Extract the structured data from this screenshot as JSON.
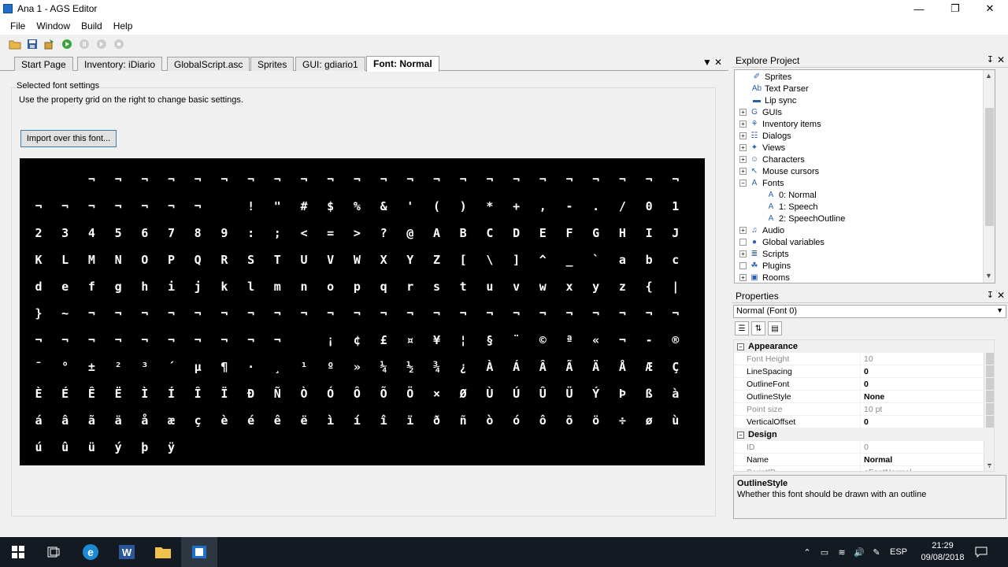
{
  "window": {
    "title": "Ana 1 - AGS Editor",
    "minimize": "—",
    "maximize": "❐",
    "close": "✕"
  },
  "menu": [
    "File",
    "Window",
    "Build",
    "Help"
  ],
  "toolbar_icons": [
    "open-folder-icon",
    "save-icon",
    "build-icon",
    "run-icon",
    "pause-icon",
    "step-icon",
    "stop-icon"
  ],
  "tabs": [
    {
      "label": "Start Page",
      "active": false
    },
    {
      "label": "Inventory: iDiario",
      "active": false
    },
    {
      "label": "GlobalScript.asc",
      "active": false
    },
    {
      "label": "Sprites",
      "active": false
    },
    {
      "label": "GUI: gdiario1",
      "active": false
    },
    {
      "label": "Font: Normal",
      "active": true
    }
  ],
  "tab_controls": {
    "dropdown": "▼",
    "close": "✕"
  },
  "font_editor": {
    "legend": "Selected font settings",
    "description": "Use the property grid on the right to change basic settings.",
    "import_button": "Import over this font...",
    "glyph_rows": [
      "  ¬¬¬¬¬¬¬¬¬¬¬¬¬¬¬¬¬¬¬¬¬¬¬",
      "¬¬¬¬¬¬¬ !\"#$%&'()*+,-./01",
      "23456789:;<=>?@ABCDEFGHIJ",
      "KLMNOPQRSTUVWXYZ[\\]^_`abc",
      "defghijklmnopqrstuvwxyz{|",
      "}~¬¬¬¬¬¬¬¬¬¬¬¬¬¬¬¬¬¬¬¬¬¬¬",
      "¬¬¬¬¬¬¬¬¬¬ ¡¢£¤¥¦§¨©ª«¬-®",
      "¯°±²³´µ¶·¸¹º»¼½¾¿ÀÁÂÃÄÅÆÇ",
      "ÈÉÊËÌÍÎÏÐÑÒÓÔÕÖ×ØÙÚÛÜÝÞßà",
      "áâãäåæçèéêëìíîïðñòóôõö÷øù",
      "úûüýþÿ"
    ]
  },
  "explore": {
    "title": "Explore Project",
    "pin": "↧",
    "close": "✕",
    "items": [
      {
        "label": "Sprites",
        "icon": "sprites-icon",
        "glyph": "✐",
        "level": 1,
        "expander": ""
      },
      {
        "label": "Text Parser",
        "icon": "text-parser-icon",
        "glyph": "Ab",
        "level": 1,
        "expander": ""
      },
      {
        "label": "Lip sync",
        "icon": "lip-sync-icon",
        "glyph": "▬",
        "level": 1,
        "expander": ""
      },
      {
        "label": "GUIs",
        "icon": "gui-icon",
        "glyph": "G",
        "level": 0,
        "expander": "+"
      },
      {
        "label": "Inventory items",
        "icon": "inventory-icon",
        "glyph": "⚘",
        "level": 0,
        "expander": "+"
      },
      {
        "label": "Dialogs",
        "icon": "dialogs-icon",
        "glyph": "☷",
        "level": 0,
        "expander": "+"
      },
      {
        "label": "Views",
        "icon": "views-icon",
        "glyph": "✦",
        "level": 0,
        "expander": "+"
      },
      {
        "label": "Characters",
        "icon": "characters-icon",
        "glyph": "☺",
        "level": 0,
        "expander": "+"
      },
      {
        "label": "Mouse cursors",
        "icon": "mouse-cursor-icon",
        "glyph": "↖",
        "level": 0,
        "expander": "+"
      },
      {
        "label": "Fonts",
        "icon": "fonts-icon",
        "glyph": "A",
        "level": 0,
        "expander": "−"
      },
      {
        "label": "0: Normal",
        "icon": "font-icon",
        "glyph": "A",
        "level": 2,
        "expander": ""
      },
      {
        "label": "1: Speech",
        "icon": "font-icon",
        "glyph": "A",
        "level": 2,
        "expander": ""
      },
      {
        "label": "2: SpeechOutline",
        "icon": "font-icon",
        "glyph": "A",
        "level": 2,
        "expander": ""
      },
      {
        "label": "Audio",
        "icon": "audio-icon",
        "glyph": "♫",
        "level": 0,
        "expander": "+"
      },
      {
        "label": "Global variables",
        "icon": "global-variables-icon",
        "glyph": "●",
        "level": 0,
        "expander": ""
      },
      {
        "label": "Scripts",
        "icon": "scripts-icon",
        "glyph": "≣",
        "level": 0,
        "expander": "+"
      },
      {
        "label": "Plugins",
        "icon": "plugins-icon",
        "glyph": "☘",
        "level": 0,
        "expander": ""
      },
      {
        "label": "Rooms",
        "icon": "rooms-icon",
        "glyph": "▣",
        "level": 0,
        "expander": "+"
      }
    ]
  },
  "properties": {
    "title": "Properties",
    "pin": "↧",
    "close": "✕",
    "selected_object": "Normal (Font 0)",
    "categories": [
      {
        "name": "Appearance",
        "props": [
          {
            "name": "Font Height",
            "value": "10",
            "readonly": true,
            "bold": false
          },
          {
            "name": "LineSpacing",
            "value": "0",
            "readonly": false,
            "bold": true
          },
          {
            "name": "OutlineFont",
            "value": "0",
            "readonly": false,
            "bold": true
          },
          {
            "name": "OutlineStyle",
            "value": "None",
            "readonly": false,
            "bold": true
          },
          {
            "name": "Point size",
            "value": "10 pt",
            "readonly": true,
            "bold": false
          },
          {
            "name": "VerticalOffset",
            "value": "0",
            "readonly": false,
            "bold": true
          }
        ]
      },
      {
        "name": "Design",
        "props": [
          {
            "name": "ID",
            "value": "0",
            "readonly": true,
            "bold": false
          },
          {
            "name": "Name",
            "value": "Normal",
            "readonly": false,
            "bold": true
          },
          {
            "name": "ScriptID",
            "value": "eFontNormal",
            "readonly": true,
            "bold": false
          }
        ]
      }
    ],
    "help_title": "OutlineStyle",
    "help_description": "Whether this font should be drawn with an outline"
  },
  "taskbar": {
    "apps": [
      "start-icon",
      "task-view-icon",
      "edge-icon",
      "word-icon",
      "file-explorer-icon",
      "ags-editor-icon"
    ],
    "language": "ESP",
    "time": "21:29",
    "date": "09/08/2018"
  },
  "colors": {
    "accent": "#3c7fb1",
    "taskbar": "#141a22",
    "preview_background": "#000000"
  }
}
